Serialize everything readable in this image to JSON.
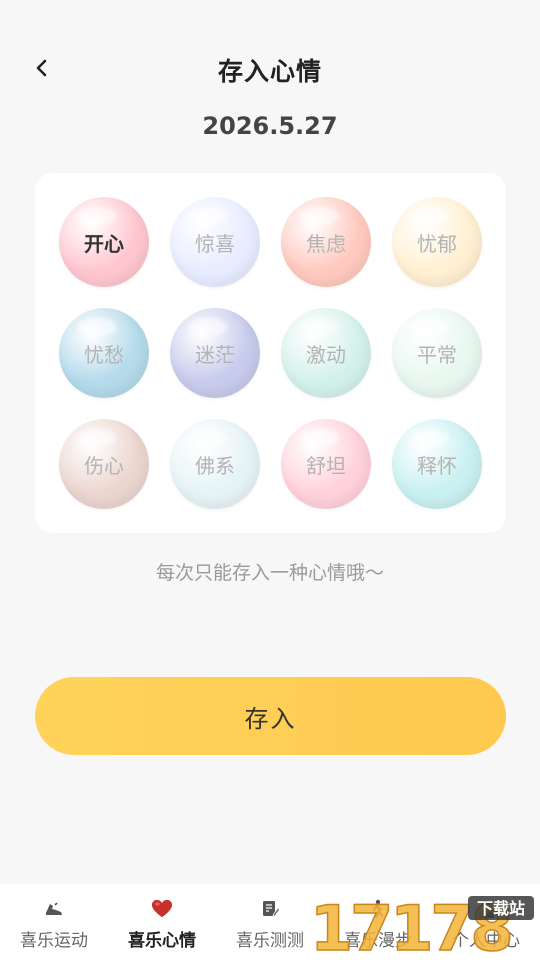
{
  "header": {
    "title": "存入心情",
    "back_icon": "chevron-left-icon"
  },
  "date": "2026.5.27",
  "moods": [
    {
      "label": "开心",
      "color": "#ffc6cf",
      "selected": true
    },
    {
      "label": "惊喜",
      "color": "#e7ecff",
      "selected": false
    },
    {
      "label": "焦虑",
      "color": "#ffc9bf",
      "selected": false
    },
    {
      "label": "忧郁",
      "color": "#fff0d2",
      "selected": false
    },
    {
      "label": "忧愁",
      "color": "#b4daeb",
      "selected": false
    },
    {
      "label": "迷茫",
      "color": "#c7cbec",
      "selected": false
    },
    {
      "label": "激动",
      "color": "#d3f1eb",
      "selected": false
    },
    {
      "label": "平常",
      "color": "#e8f7f0",
      "selected": false
    },
    {
      "label": "伤心",
      "color": "#ebd6cf",
      "selected": false
    },
    {
      "label": "佛系",
      "color": "#e6f3f6",
      "selected": false
    },
    {
      "label": "舒坦",
      "color": "#ffd1da",
      "selected": false
    },
    {
      "label": "释怀",
      "color": "#c9f0f2",
      "selected": false
    }
  ],
  "hint": "每次只能存入一种心情哦～",
  "save_label": "存入",
  "tabs": [
    {
      "label": "喜乐运动",
      "icon": "shoe-icon",
      "active": false
    },
    {
      "label": "喜乐心情",
      "icon": "heart-icon",
      "active": true
    },
    {
      "label": "喜乐测测",
      "icon": "note-edit-icon",
      "active": false
    },
    {
      "label": "喜乐漫步",
      "icon": "walk-icon",
      "active": false
    },
    {
      "label": "个人中心",
      "icon": "person-icon",
      "active": false
    }
  ],
  "watermark": {
    "text": "17178",
    "badge": "下载站"
  },
  "colors": {
    "accent": "#ffcc52",
    "heart": "#c8302c"
  }
}
